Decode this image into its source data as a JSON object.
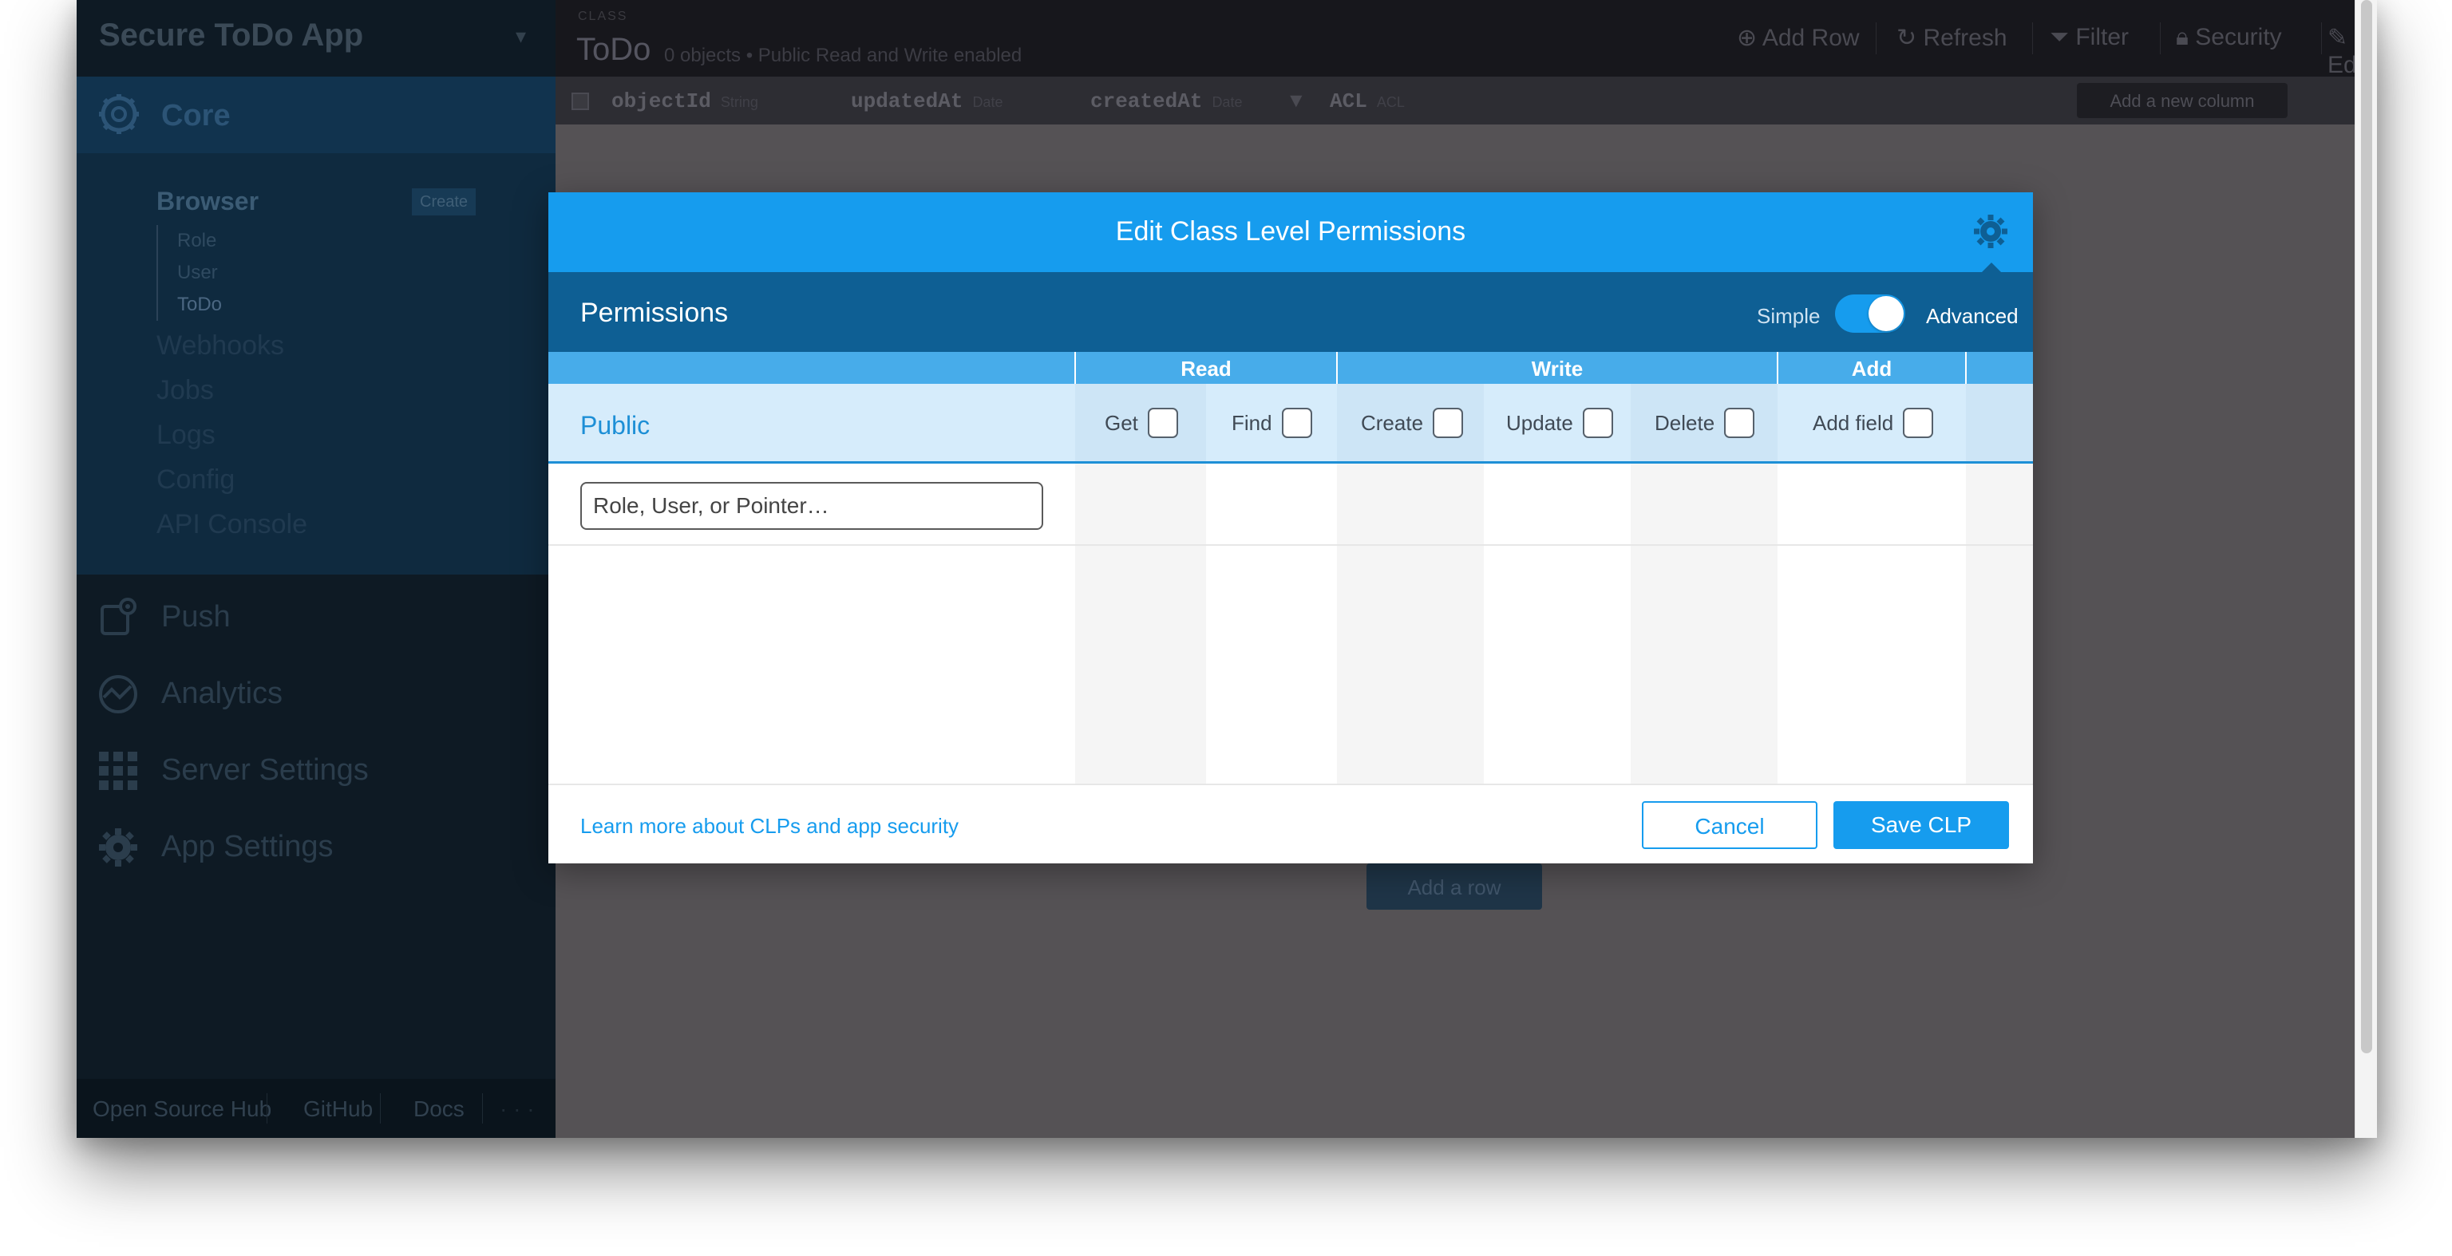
{
  "sidebar": {
    "app_title": "Secure ToDo App",
    "core": {
      "label": "Core",
      "browser_label": "Browser",
      "create_label": "Create",
      "classes": [
        "Role",
        "User",
        "ToDo"
      ],
      "nav": [
        "Webhooks",
        "Jobs",
        "Logs",
        "Config",
        "API Console"
      ]
    },
    "sections": [
      {
        "label": "Push",
        "icon": "push-icon"
      },
      {
        "label": "Analytics",
        "icon": "analytics-icon"
      },
      {
        "label": "Server Settings",
        "icon": "grid-icon"
      },
      {
        "label": "App Settings",
        "icon": "gear-icon"
      }
    ],
    "footer": [
      "Open Source Hub",
      "GitHub",
      "Docs",
      "· · ·"
    ]
  },
  "toolbar": {
    "class_tag": "CLASS",
    "class_name": "ToDo",
    "class_sub": "0 objects • Public Read and Write enabled",
    "actions": [
      "Add Row",
      "Refresh",
      "Filter",
      "Security",
      "Edit"
    ]
  },
  "columns": [
    {
      "name": "objectId",
      "type": "String"
    },
    {
      "name": "updatedAt",
      "type": "Date"
    },
    {
      "name": "createdAt",
      "type": "Date"
    },
    {
      "name": "ACL",
      "type": "ACL"
    }
  ],
  "add_column_label": "Add a new column",
  "add_row_label": "Add a row",
  "modal": {
    "title": "Edit Class Level Permissions",
    "permissions_label": "Permissions",
    "mode_simple": "Simple",
    "mode_advanced": "Advanced",
    "groups": [
      "Read",
      "Write",
      "Add"
    ],
    "public_label": "Public",
    "perms": [
      "Get",
      "Find",
      "Create",
      "Update",
      "Delete",
      "Add field"
    ],
    "entry_placeholder": "Role, User, or Pointer…",
    "learn_more": "Learn more about CLPs and app security",
    "cancel": "Cancel",
    "save": "Save CLP"
  },
  "colors": {
    "accent": "#169cee",
    "accent_dark": "#0e5f94",
    "public_row": "#d6ecfb"
  }
}
